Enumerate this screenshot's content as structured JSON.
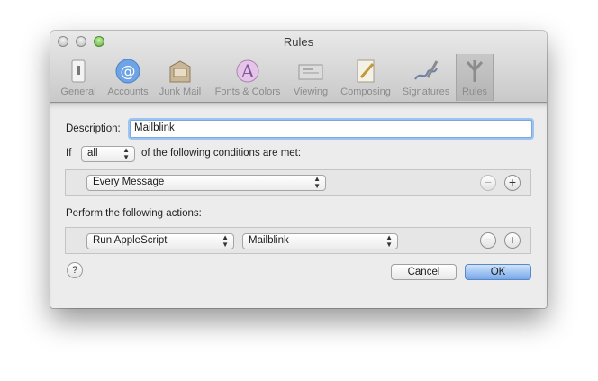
{
  "window": {
    "title": "Rules"
  },
  "toolbar": {
    "items": [
      {
        "label": "General",
        "icon": "general-icon"
      },
      {
        "label": "Accounts",
        "icon": "at-icon"
      },
      {
        "label": "Junk Mail",
        "icon": "junk-mail-icon"
      },
      {
        "label": "Fonts & Colors",
        "icon": "fonts-colors-icon"
      },
      {
        "label": "Viewing",
        "icon": "viewing-icon"
      },
      {
        "label": "Composing",
        "icon": "composing-icon"
      },
      {
        "label": "Signatures",
        "icon": "signatures-icon"
      },
      {
        "label": "Rules",
        "icon": "rules-icon"
      }
    ],
    "selected": "Rules"
  },
  "sheet": {
    "description_label": "Description:",
    "description_value": "Mailblink",
    "if_label": "If",
    "match_select": "all",
    "conditions_suffix": "of the following conditions are met:",
    "condition": {
      "select": "Every Message"
    },
    "actions_label": "Perform the following actions:",
    "action": {
      "select": "Run AppleScript",
      "script_select": "Mailblink"
    },
    "remove_symbol": "−",
    "add_symbol": "+",
    "help_symbol": "?",
    "cancel_label": "Cancel",
    "ok_label": "OK"
  }
}
